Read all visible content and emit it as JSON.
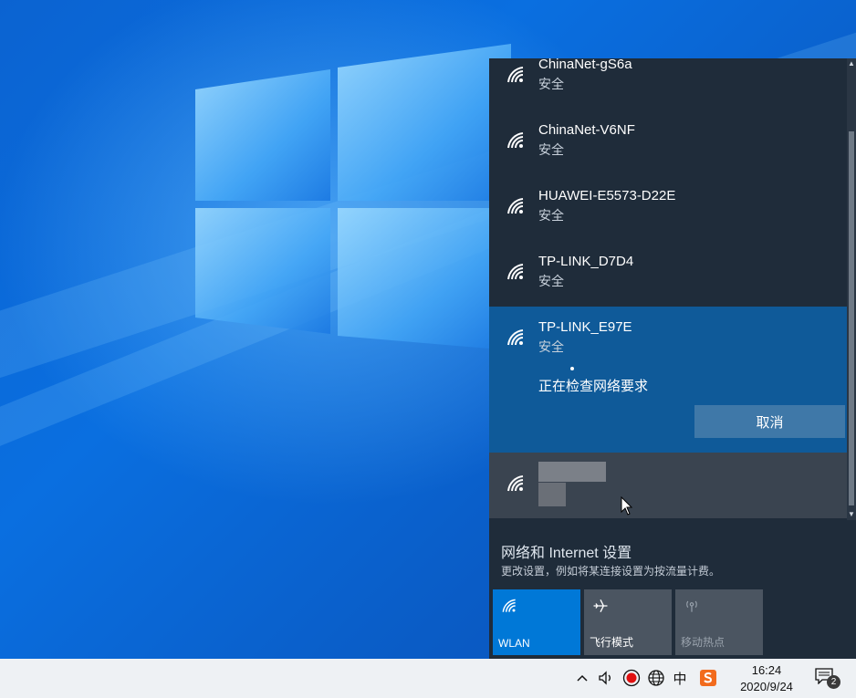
{
  "flyout": {
    "networks": [
      {
        "name": "ChinaNet-gS6a",
        "status": "安全"
      },
      {
        "name": "ChinaNet-V6NF",
        "status": "安全"
      },
      {
        "name": "HUAWEI-E5573-D22E",
        "status": "安全"
      },
      {
        "name": "TP-LINK_D7D4",
        "status": "安全"
      },
      {
        "name": "TP-LINK_E97E",
        "status": "安全",
        "checking_text": "正在检查网络要求",
        "cancel_label": "取消"
      }
    ],
    "settings_title": "网络和 Internet 设置",
    "settings_subtitle": "更改设置，例如将某连接设置为按流量计费。",
    "tiles": [
      {
        "label": "WLAN",
        "icon": "wifi-icon",
        "active": true
      },
      {
        "label": "飞行模式",
        "icon": "airplane-icon",
        "active": false
      },
      {
        "label": "移动热点",
        "icon": "hotspot-icon",
        "active": false,
        "disabled": true
      }
    ]
  },
  "taskbar": {
    "ime_label": "中",
    "time": "16:24",
    "date": "2020/9/24",
    "notification_count": "2"
  },
  "colors": {
    "accent": "#0078d7",
    "selected_item": "#0f5a99",
    "flyout_bg": "#1f2c3a"
  }
}
